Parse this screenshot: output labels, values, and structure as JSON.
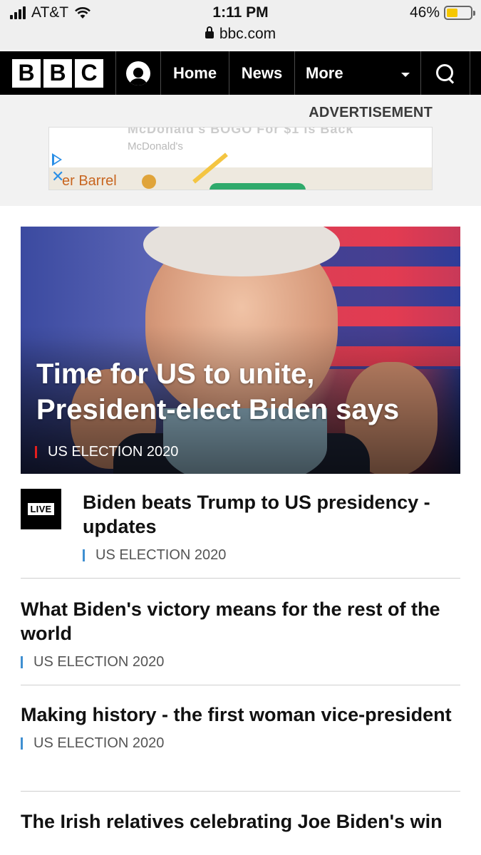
{
  "status_bar": {
    "carrier": "AT&T",
    "time": "1:11 PM",
    "battery_percent": "46%",
    "battery_level": 0.46,
    "url": "bbc.com"
  },
  "nav": {
    "logo_letters": [
      "B",
      "B",
      "C"
    ],
    "home": "Home",
    "news": "News",
    "more": "More"
  },
  "ad": {
    "label": "ADVERTISEMENT",
    "faded_headline": "McDonald's BOGO For $1 Is Back",
    "brand": "McDonald's",
    "place": "er Barrel"
  },
  "hero": {
    "title": "Time for US to unite, President-elect Biden says",
    "tag": "US ELECTION 2020",
    "tag_color": "#e31e1e"
  },
  "stories": [
    {
      "badge": "LIVE",
      "title": "Biden beats Trump to US presidency - updates",
      "tag": "US ELECTION 2020"
    },
    {
      "title": "What Biden's victory means for the rest of the world",
      "tag": "US ELECTION 2020"
    },
    {
      "title": "Making history - the first woman vice-president",
      "tag": "US ELECTION 2020"
    },
    {
      "title": "The Irish relatives celebrating Joe Biden's win"
    }
  ],
  "colors": {
    "tag_accent": "#3f8fd1",
    "nav_bg": "#000000"
  }
}
